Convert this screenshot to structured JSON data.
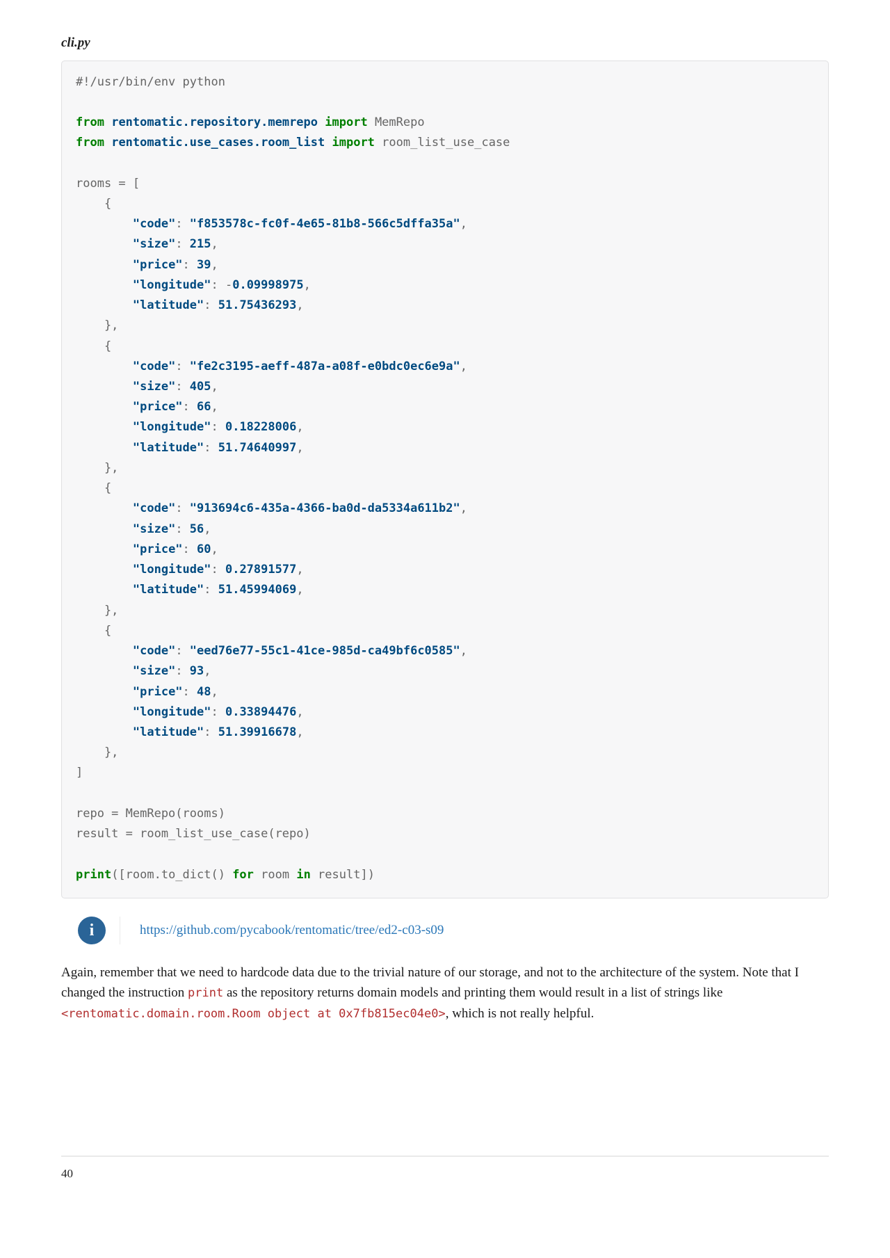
{
  "caption": "cli.py",
  "code": {
    "shebang": "#!/usr/bin/env python",
    "imp1_from": "from",
    "imp1_mod": "rentomatic.repository.memrepo",
    "imp1_imp": "import",
    "imp1_what": "MemRepo",
    "imp2_from": "from",
    "imp2_mod": "rentomatic.use_cases.room_list",
    "imp2_imp": "import",
    "imp2_what": "room_list_use_case",
    "rooms_var": "rooms = [",
    "brace_open": "    {",
    "brace_close": "    },",
    "list_close": "]",
    "r1_code_k": "\"code\"",
    "r1_code_v": "\"f853578c-fc0f-4e65-81b8-566c5dffa35a\"",
    "r1_size_k": "\"size\"",
    "r1_size_v": "215",
    "r1_price_k": "\"price\"",
    "r1_price_v": "39",
    "r1_lon_k": "\"longitude\"",
    "r1_lon_minus": "-",
    "r1_lon_v": "0.09998975",
    "r1_lat_k": "\"latitude\"",
    "r1_lat_v": "51.75436293",
    "r2_code_k": "\"code\"",
    "r2_code_v": "\"fe2c3195-aeff-487a-a08f-e0bdc0ec6e9a\"",
    "r2_size_k": "\"size\"",
    "r2_size_v": "405",
    "r2_price_k": "\"price\"",
    "r2_price_v": "66",
    "r2_lon_k": "\"longitude\"",
    "r2_lon_v": "0.18228006",
    "r2_lat_k": "\"latitude\"",
    "r2_lat_v": "51.74640997",
    "r3_code_k": "\"code\"",
    "r3_code_v": "\"913694c6-435a-4366-ba0d-da5334a611b2\"",
    "r3_size_k": "\"size\"",
    "r3_size_v": "56",
    "r3_price_k": "\"price\"",
    "r3_price_v": "60",
    "r3_lon_k": "\"longitude\"",
    "r3_lon_v": "0.27891577",
    "r3_lat_k": "\"latitude\"",
    "r3_lat_v": "51.45994069",
    "r4_code_k": "\"code\"",
    "r4_code_v": "\"eed76e77-55c1-41ce-985d-ca49bf6c0585\"",
    "r4_size_k": "\"size\"",
    "r4_size_v": "93",
    "r4_price_k": "\"price\"",
    "r4_price_v": "48",
    "r4_lon_k": "\"longitude\"",
    "r4_lon_v": "0.33894476",
    "r4_lat_k": "\"latitude\"",
    "r4_lat_v": "51.39916678",
    "repo_line": "repo = MemRepo(rooms)",
    "result_line": "result = room_list_use_case(repo)",
    "print_kw": "print",
    "print_open": "([room.to_dict() ",
    "for_kw": "for",
    "print_mid": " room ",
    "in_kw": "in",
    "print_end": " result])"
  },
  "info_link": "https://github.com/pycabook/rentomatic/tree/ed2-c03-s09",
  "para_before": "Again, remember that we need to hardcode data due to the trivial nature of our storage, and not to the architecture of the system. Note that I changed the instruction ",
  "para_code1": "print",
  "para_mid": " as the repository returns domain models and printing them would result in a list of strings like ",
  "para_code2": "<rentomatic.domain.room.Room object at 0x7fb815ec04e0>",
  "para_after": ", which is not really helpful.",
  "page_number": "40"
}
